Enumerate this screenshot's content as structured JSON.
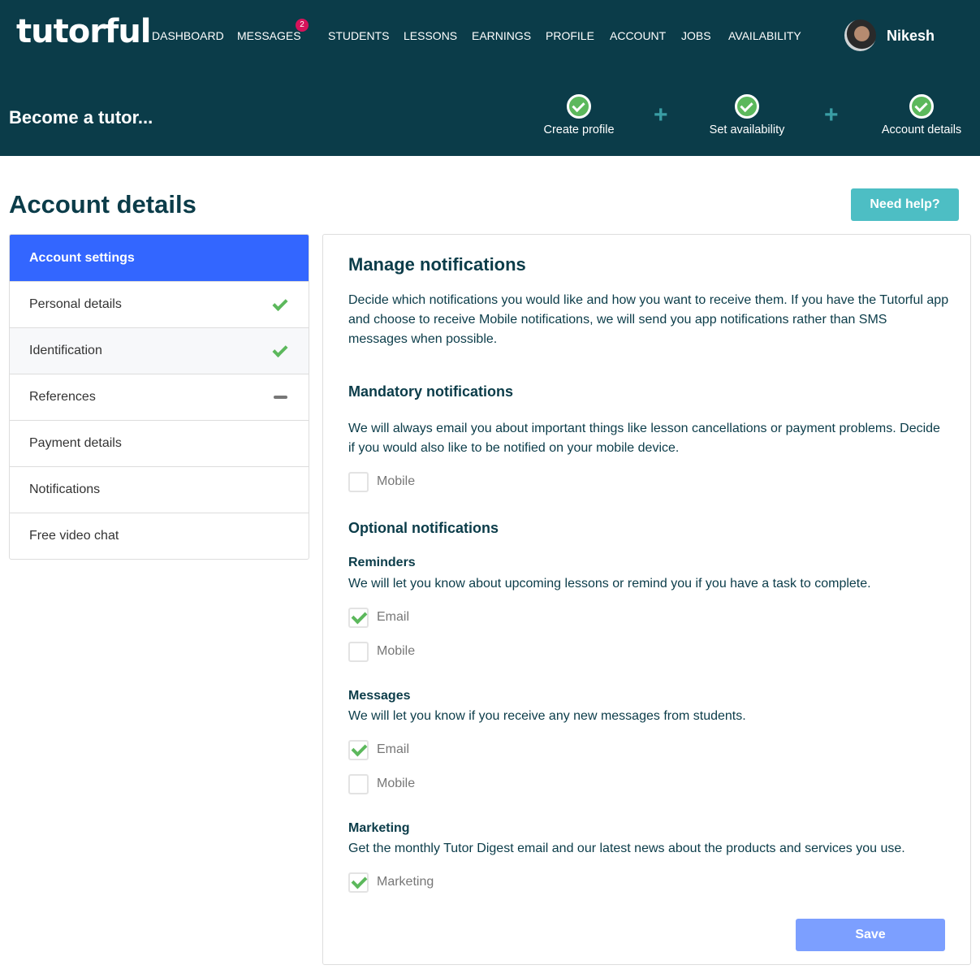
{
  "header": {
    "logo": "tutorful",
    "nav": [
      "DASHBOARD",
      "MESSAGES",
      "STUDENTS",
      "LESSONS",
      "EARNINGS",
      "PROFILE",
      "ACCOUNT",
      "JOBS",
      "AVAILABILITY"
    ],
    "messages_badge": "2",
    "user_name": "Nikesh",
    "become": "Become a tutor...",
    "steps": [
      {
        "label": "Create profile",
        "done": true
      },
      {
        "label": "Set availability",
        "done": true
      },
      {
        "label": "Account details",
        "done": true
      }
    ]
  },
  "page": {
    "title": "Account details",
    "help_label": "Need help?"
  },
  "sidebar": {
    "header": "Account settings",
    "items": [
      {
        "label": "Personal details",
        "status": "complete"
      },
      {
        "label": "Identification",
        "status": "complete"
      },
      {
        "label": "References",
        "status": "pending"
      },
      {
        "label": "Payment details",
        "status": ""
      },
      {
        "label": "Notifications",
        "status": ""
      },
      {
        "label": "Free video chat",
        "status": ""
      }
    ]
  },
  "main": {
    "title": "Manage notifications",
    "intro": "Decide which notifications you would like and how you want to receive them. If you have the Tutorful app and choose to receive Mobile notifications, we will send you app notifications rather than SMS messages when possible.",
    "mandatory": {
      "title": "Mandatory notifications",
      "text": "We will always email you about important things like lesson cancellations or payment problems. Decide if you would also like to be notified on your mobile device.",
      "mobile": {
        "label": "Mobile",
        "checked": false
      }
    },
    "optional_title": "Optional notifications",
    "reminders": {
      "title": "Reminders",
      "text": "We will let you know about upcoming lessons or remind you if you have a task to complete.",
      "email": {
        "label": "Email",
        "checked": true
      },
      "mobile": {
        "label": "Mobile",
        "checked": false
      }
    },
    "messages": {
      "title": "Messages",
      "text": "We will let you know if you receive any new messages from students.",
      "email": {
        "label": "Email",
        "checked": true
      },
      "mobile": {
        "label": "Mobile",
        "checked": false
      }
    },
    "marketing": {
      "title": "Marketing",
      "text": "Get the monthly Tutor Digest email and our latest news about the products and services you use.",
      "marketing": {
        "label": "Marketing",
        "checked": true
      }
    },
    "save_label": "Save"
  },
  "colors": {
    "header_bg": "#0b3c49",
    "accent_blue": "#3366ff",
    "help_teal": "#4dbec4",
    "success": "#5cb85c",
    "badge": "#d6135a"
  }
}
